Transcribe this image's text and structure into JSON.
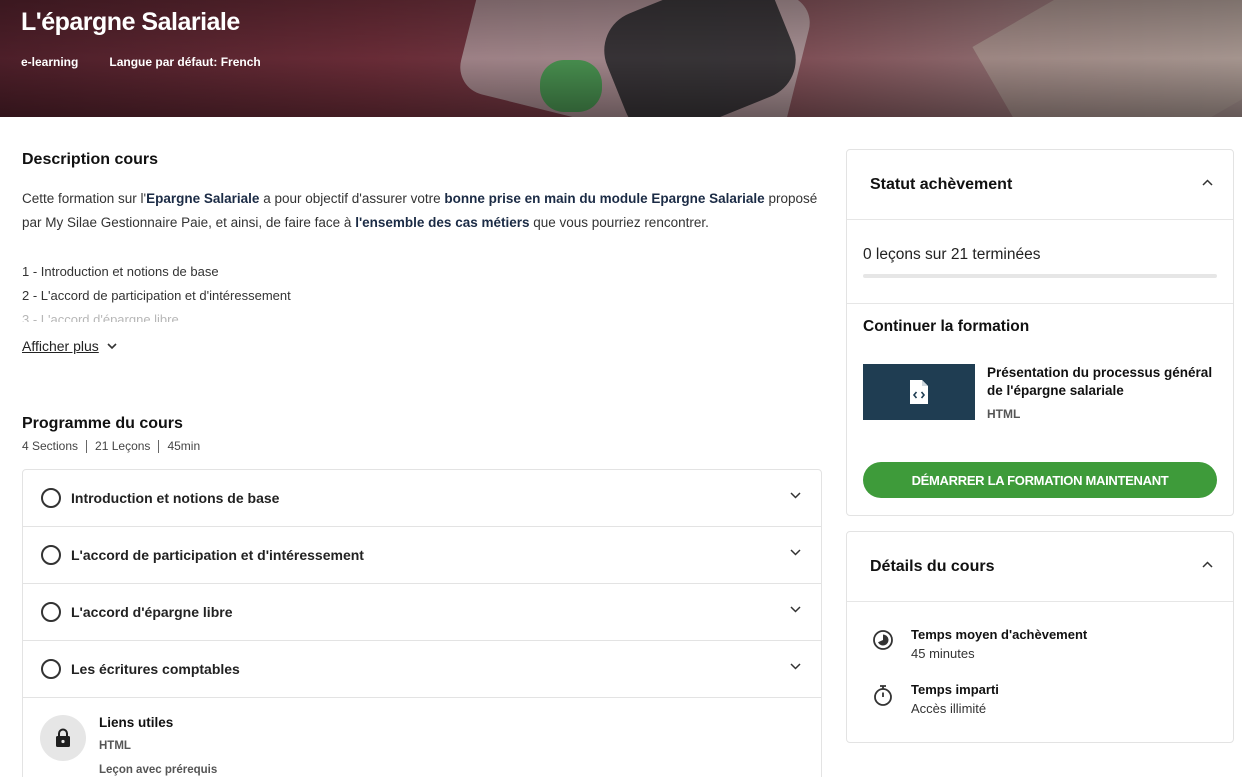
{
  "hero": {
    "title": "L'épargne Salariale",
    "type": "e-learning",
    "language": "Langue par défaut: French"
  },
  "description": {
    "heading": "Description cours",
    "p1_a": "Cette formation sur l'",
    "p1_b": "Epargne Salariale",
    "p1_c": " a pour objectif d'assurer votre ",
    "p1_d": "bonne prise en main du module Epargne Salariale",
    "p1_e": " proposé par My Silae Gestionnaire Paie, et ainsi, de faire face à ",
    "p1_f": "l'ensemble des cas métiers",
    "p1_g": " que vous pourriez rencontrer.",
    "items": [
      "1 - Introduction et notions de base",
      "2 - L'accord de participation et d'intéressement",
      "3 - L'accord d'épargne libre"
    ],
    "show_more": "Afficher plus"
  },
  "program": {
    "heading": "Programme du cours",
    "sections_count": "4 Sections",
    "lessons_count": "21 Leçons",
    "duration": "45min",
    "sections": [
      "Introduction et notions de base",
      "L'accord de participation et d'intéressement",
      "L'accord d'épargne libre",
      "Les écritures comptables"
    ],
    "lesson": {
      "title": "Liens utiles",
      "type": "HTML",
      "note": "Leçon avec prérequis"
    }
  },
  "completion": {
    "heading": "Statut achèvement",
    "progress_text": "0 leçons sur 21 terminées",
    "progress_fraction": 0,
    "continue_heading": "Continuer la formation",
    "next_lesson_title": "Présentation du processus général de l'épargne salariale",
    "next_lesson_type": "HTML",
    "start_button": "DÉMARRER LA FORMATION MAINTENANT"
  },
  "details": {
    "heading": "Détails du cours",
    "avg_label": "Temps moyen d'achèvement",
    "avg_value": "45 minutes",
    "limit_label": "Temps imparti",
    "limit_value": "Accès illimité"
  },
  "colors": {
    "accent_green": "#3e9b3a",
    "thumb_bg": "#1f3d52",
    "emphasis_text": "#1b2b45"
  }
}
